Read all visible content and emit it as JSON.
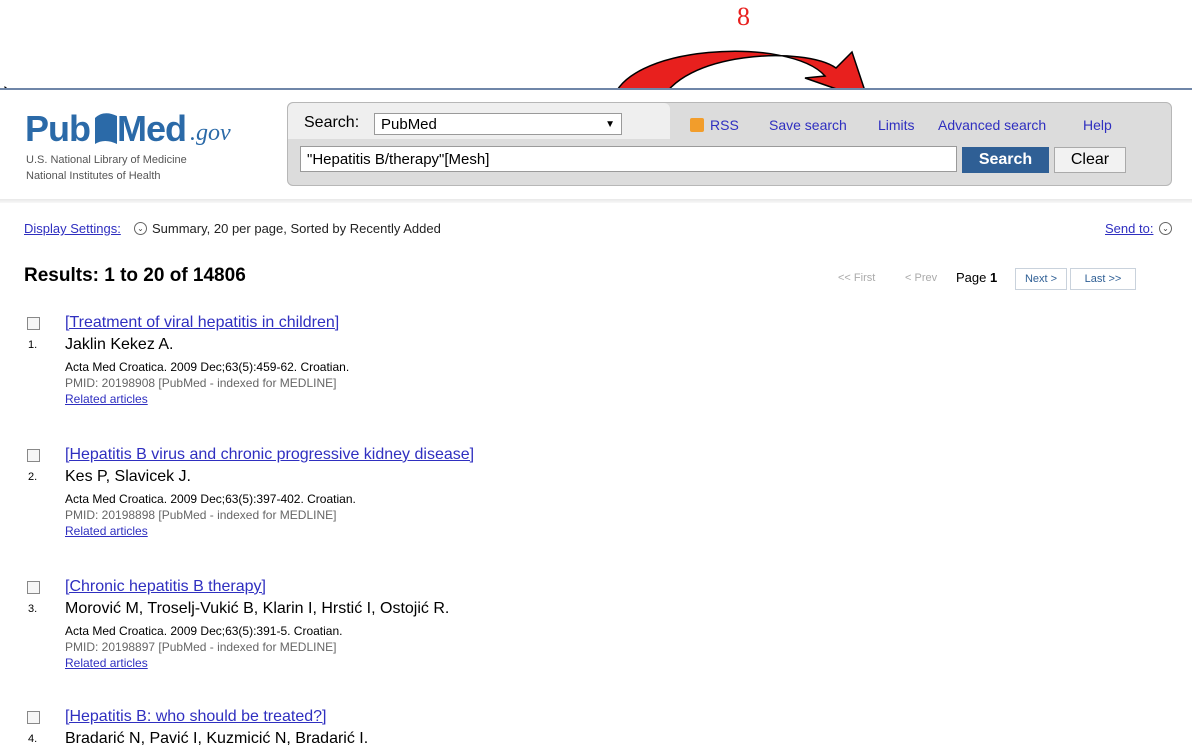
{
  "annotation": {
    "step_number": "8",
    "arrow_color": "#e8201e"
  },
  "header": {
    "logo_pub": "Pub",
    "logo_med": "Med",
    "logo_gov": ".gov",
    "nlm_line1": "U.S. National Library of Medicine",
    "nlm_line2": "National Institutes of Health",
    "search_label": "Search:",
    "database": "PubMed",
    "query": "\"Hepatitis B/therapy\"[Mesh]",
    "search_button": "Search",
    "clear_button": "Clear",
    "links": {
      "rss": "RSS",
      "save_search": "Save search",
      "limits": "Limits",
      "advanced_search": "Advanced search",
      "help": "Help"
    },
    "brand_color": "#2b6aa8",
    "button_color": "#2f5f95"
  },
  "display": {
    "settings_label": "Display Settings:",
    "summary": "Summary, 20 per page, Sorted by Recently Added",
    "send_to": "Send to:"
  },
  "results": {
    "title": "Results: 1 to 20 of 14806",
    "pager": {
      "first": "<< First",
      "prev": "< Prev",
      "page_label": "Page",
      "page_number": "1",
      "next": "Next >",
      "last": "Last >>"
    },
    "items": [
      {
        "number": "1.",
        "title": "[Treatment of viral hepatitis in children]",
        "authors": "Jaklin Kekez A.",
        "source": "Acta Med Croatica. 2009 Dec;63(5):459-62. Croatian.",
        "pmid": "PMID: 20198908 [PubMed - indexed for MEDLINE]",
        "related": "Related articles"
      },
      {
        "number": "2.",
        "title": "[Hepatitis B virus and chronic progressive kidney disease]",
        "authors": "Kes P, Slavicek J.",
        "source": "Acta Med Croatica. 2009 Dec;63(5):397-402. Croatian.",
        "pmid": "PMID: 20198898 [PubMed - indexed for MEDLINE]",
        "related": "Related articles"
      },
      {
        "number": "3.",
        "title": "[Chronic hepatitis B therapy]",
        "authors": "Morović M, Troselj-Vukić B, Klarin I, Hrstić I, Ostojić R.",
        "source": "Acta Med Croatica. 2009 Dec;63(5):391-5. Croatian.",
        "pmid": "PMID: 20198897 [PubMed - indexed for MEDLINE]",
        "related": "Related articles"
      },
      {
        "number": "4.",
        "title": "[Hepatitis B: who should be treated?]",
        "authors": "Bradarić N, Pavić I, Kuzmicić N, Bradarić I."
      }
    ]
  }
}
